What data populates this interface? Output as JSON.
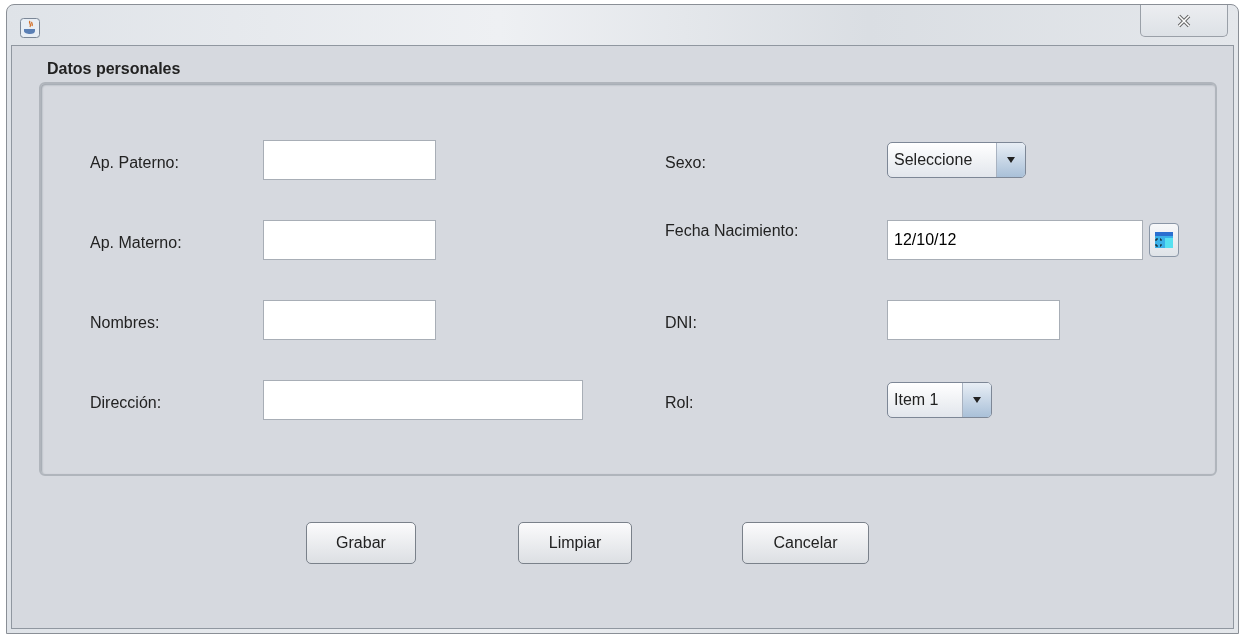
{
  "panel": {
    "title": "Datos personales",
    "left_fields": [
      {
        "label": "Ap. Paterno:",
        "kind": "text",
        "wide": false
      },
      {
        "label": "Ap. Materno:",
        "kind": "text",
        "wide": false
      },
      {
        "label": "Nombres:",
        "kind": "text",
        "wide": false
      },
      {
        "label": "Dirección:",
        "kind": "text",
        "wide": true
      }
    ],
    "right_fields": [
      {
        "label": "Sexo:",
        "kind": "combo",
        "value": "Seleccione"
      },
      {
        "label": "Fecha Nacimiento:",
        "kind": "date",
        "value": "12/10/12"
      },
      {
        "label": "DNI:",
        "kind": "text"
      },
      {
        "label": "Rol:",
        "kind": "combo",
        "value": "Item 1"
      }
    ]
  },
  "buttons": [
    "Grabar",
    "Limpiar",
    "Cancelar"
  ]
}
